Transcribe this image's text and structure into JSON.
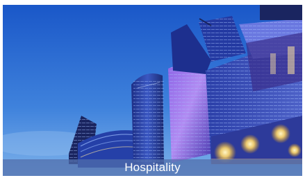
{
  "tile": {
    "caption": "Hospitality",
    "image_subject": "skyscrapers-photo",
    "colors": {
      "sky_top": "#1f5fd0",
      "sky_bottom": "#6fa7e6",
      "glass_dark": "#1a2c7a",
      "glass_purple": "#7a4fd6",
      "light_warm": "#ffe9a0",
      "caption_bar": "#506eaa"
    }
  }
}
